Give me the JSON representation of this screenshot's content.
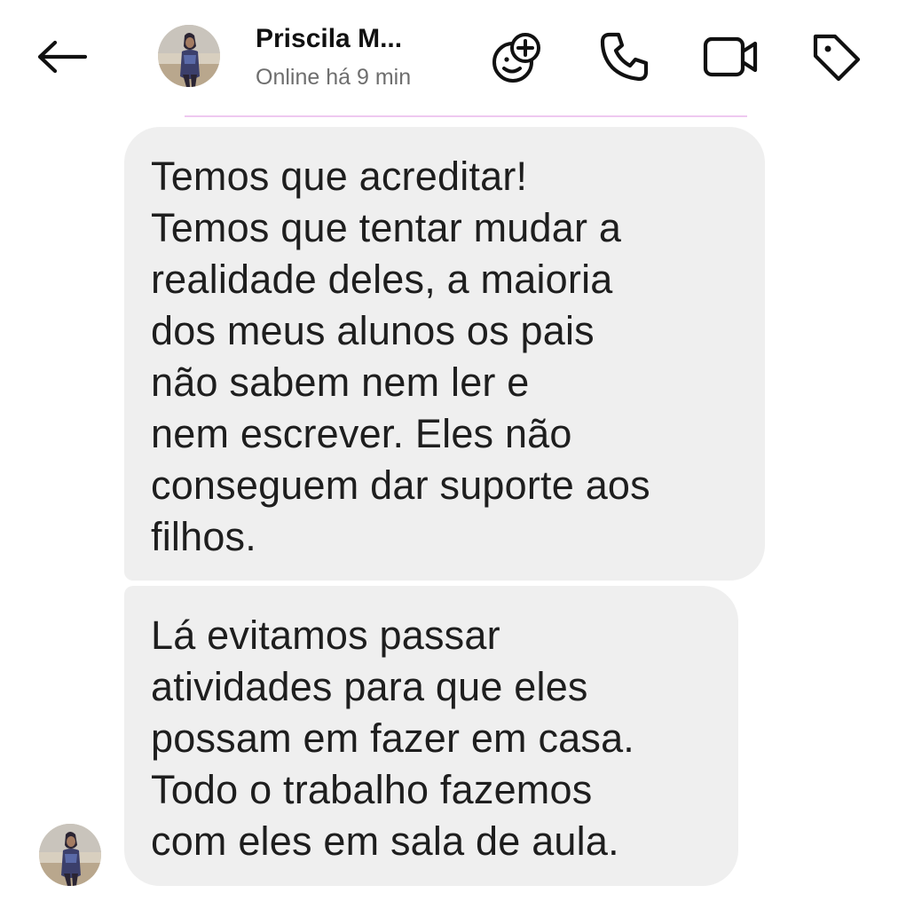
{
  "header": {
    "contact_name": "Priscila M...",
    "status": "Online há 9 min",
    "icons": {
      "back": "arrow-left-icon",
      "effects": "sticker-add-icon",
      "call": "phone-icon",
      "video": "video-camera-icon",
      "tag": "tag-icon"
    }
  },
  "colors": {
    "bubble": "#efefef",
    "divider": "#efc9f0",
    "text": "#1e1e1e",
    "status": "#6e6e6e"
  },
  "messages": [
    {
      "lines": [
        "Temos que acreditar!",
        "Temos que tentar mudar a",
        "realidade deles, a maioria",
        "dos meus alunos os pais",
        "não sabem nem ler e",
        "nem escrever. Eles não",
        "conseguem dar suporte aos",
        "filhos."
      ]
    },
    {
      "lines": [
        "Lá evitamos passar",
        "atividades para que eles",
        "possam em fazer em casa.",
        "Todo o trabalho fazemos",
        "com eles em sala de aula."
      ]
    }
  ]
}
